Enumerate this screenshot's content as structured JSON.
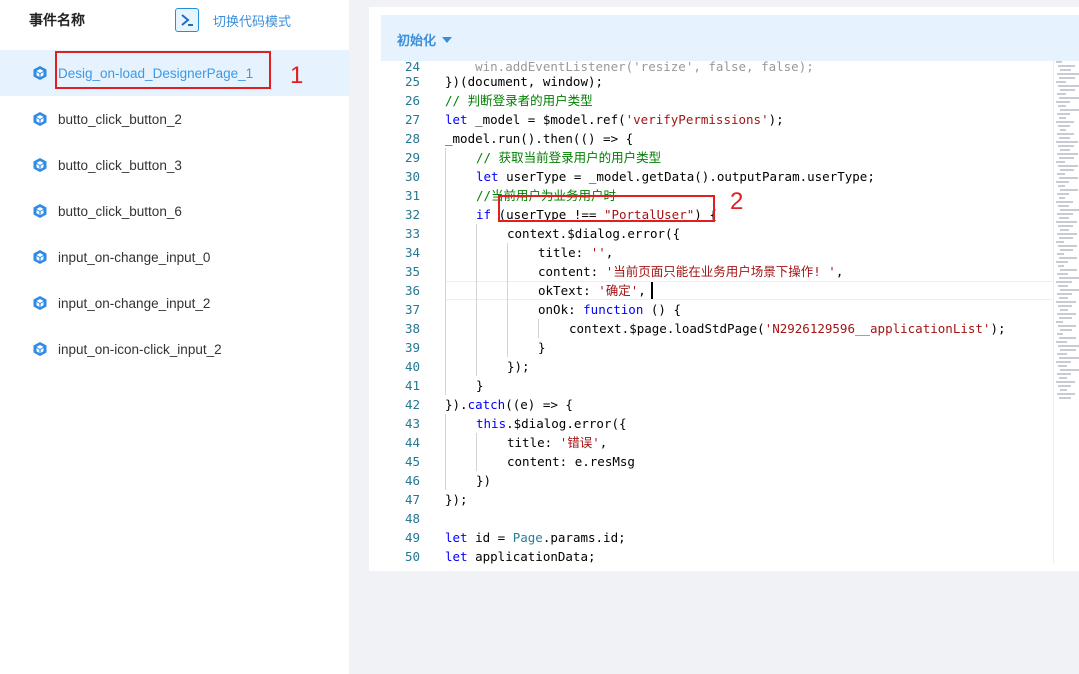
{
  "sidebar": {
    "title": "事件名称",
    "code_mode_label": "切换代码模式",
    "items": [
      {
        "label": "Desig_on-load_DesignerPage_1",
        "active": true
      },
      {
        "label": "butto_click_button_2",
        "active": false
      },
      {
        "label": "butto_click_button_3",
        "active": false
      },
      {
        "label": "butto_click_button_6",
        "active": false
      },
      {
        "label": "input_on-change_input_0",
        "active": false
      },
      {
        "label": "input_on-change_input_2",
        "active": false
      },
      {
        "label": "input_on-icon-click_input_2",
        "active": false
      }
    ]
  },
  "annotations": {
    "one": "1",
    "two": "2"
  },
  "editor": {
    "dropdown_label": "初始化",
    "lines": [
      {
        "n": "25",
        "i": 0,
        "segs": [
          [
            "t",
            "})(document, window);"
          ]
        ]
      },
      {
        "n": "26",
        "i": 0,
        "segs": [
          [
            "cm",
            "// 判断登录者的用户类型"
          ]
        ]
      },
      {
        "n": "27",
        "i": 0,
        "segs": [
          [
            "kw",
            "let"
          ],
          [
            "t",
            " _model = $model.ref("
          ],
          [
            "str",
            "'verifyPermissions'"
          ],
          [
            "t",
            ");"
          ]
        ]
      },
      {
        "n": "28",
        "i": 0,
        "segs": [
          [
            "t",
            "_model.run().then(() => {"
          ]
        ]
      },
      {
        "n": "29",
        "i": 1,
        "segs": [
          [
            "cm",
            "// 获取当前登录用户的用户类型"
          ]
        ]
      },
      {
        "n": "30",
        "i": 1,
        "segs": [
          [
            "kw",
            "let"
          ],
          [
            "t",
            " userType = _model.getData().outputParam.userType;"
          ]
        ]
      },
      {
        "n": "31",
        "i": 1,
        "segs": [
          [
            "cm",
            "//当前用户为业务用户时"
          ]
        ]
      },
      {
        "n": "32",
        "i": 1,
        "segs": [
          [
            "kw",
            "if"
          ],
          [
            "t",
            " (userType !== "
          ],
          [
            "str",
            "\"PortalUser\""
          ],
          [
            "t",
            ") {"
          ]
        ]
      },
      {
        "n": "33",
        "i": 2,
        "segs": [
          [
            "t",
            "context.$dialog.error({"
          ]
        ]
      },
      {
        "n": "34",
        "i": 3,
        "segs": [
          [
            "t",
            "title: "
          ],
          [
            "str",
            "''"
          ],
          [
            "t",
            ","
          ]
        ]
      },
      {
        "n": "35",
        "i": 3,
        "segs": [
          [
            "t",
            "content: "
          ],
          [
            "str",
            "'当前页面只能在业务用户场景下操作! '"
          ],
          [
            "t",
            ","
          ]
        ]
      },
      {
        "n": "36",
        "i": 3,
        "segs": [
          [
            "t",
            "okText: "
          ],
          [
            "str",
            "'确定'"
          ],
          [
            "t",
            ","
          ]
        ]
      },
      {
        "n": "37",
        "i": 3,
        "segs": [
          [
            "t",
            "onOk: "
          ],
          [
            "kw",
            "function"
          ],
          [
            "t",
            " () {"
          ]
        ]
      },
      {
        "n": "38",
        "i": 4,
        "segs": [
          [
            "t",
            "context.$page.loadStdPage("
          ],
          [
            "str",
            "'N2926129596__applicationList'"
          ],
          [
            "t",
            ");"
          ]
        ]
      },
      {
        "n": "39",
        "i": 3,
        "segs": [
          [
            "t",
            "}"
          ]
        ]
      },
      {
        "n": "40",
        "i": 2,
        "segs": [
          [
            "t",
            "});"
          ]
        ]
      },
      {
        "n": "41",
        "i": 1,
        "segs": [
          [
            "t",
            "}"
          ]
        ]
      },
      {
        "n": "42",
        "i": 0,
        "segs": [
          [
            "t",
            "})."
          ],
          [
            "kw",
            "catch"
          ],
          [
            "t",
            "((e) => {"
          ]
        ]
      },
      {
        "n": "43",
        "i": 1,
        "segs": [
          [
            "kw",
            "this"
          ],
          [
            "t",
            ".$dialog.error({"
          ]
        ]
      },
      {
        "n": "44",
        "i": 2,
        "segs": [
          [
            "t",
            "title: "
          ],
          [
            "str",
            "'错误'"
          ],
          [
            "t",
            ","
          ]
        ]
      },
      {
        "n": "45",
        "i": 2,
        "segs": [
          [
            "t",
            "content: e.resMsg"
          ]
        ]
      },
      {
        "n": "46",
        "i": 1,
        "segs": [
          [
            "t",
            "})"
          ]
        ]
      },
      {
        "n": "47",
        "i": 0,
        "segs": [
          [
            "t",
            "});"
          ]
        ]
      },
      {
        "n": "48",
        "i": 0,
        "segs": []
      },
      {
        "n": "49",
        "i": 0,
        "segs": [
          [
            "kw",
            "let"
          ],
          [
            "t",
            " id = "
          ],
          [
            "cls",
            "Page"
          ],
          [
            "t",
            ".params.id;"
          ]
        ]
      },
      {
        "n": "50",
        "i": 0,
        "segs": [
          [
            "kw",
            "let"
          ],
          [
            "t",
            " applicationData;"
          ]
        ]
      }
    ]
  }
}
